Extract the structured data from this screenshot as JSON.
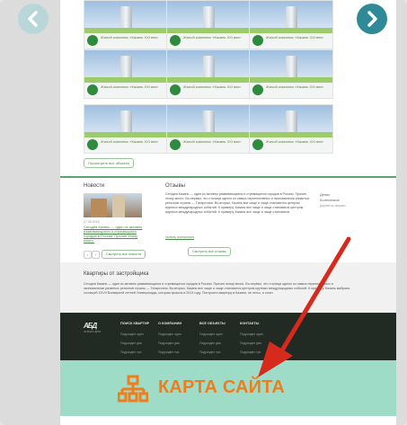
{
  "navigation": {
    "prev_icon": "chevron-left-icon",
    "next_icon": "chevron-right-icon"
  },
  "projects": {
    "tile_caption": "Жилой комплекс «Казань XXI век»",
    "logo_text": "Ак Барс Дом",
    "show_all": "Посмотреть все объекты"
  },
  "news": {
    "title": "Новости",
    "date": "27.08.2015",
    "link": "Сегодня Казань — один из активно развивающихся и стремящихся городов в России. Причин этому много.",
    "pager": [
      "‹",
      "›"
    ],
    "all": "Смотреть все новости"
  },
  "reviews": {
    "title": "Отзывы",
    "text": "Сегодня Казань — один из активно развивающихся и стремящихся городов в России. Причин этому много. Во-первых, это столица одного из самых перспективных и экономически развитых регионов страны — Татарстана. Во-вторых, Казань все чаще и чаще становится центром крупных международных событий. К примеру, Казань все чаще и чаще становится центром крупных международных событий. К примеру, Казань все чаще и чаще становится.",
    "more": "Читать полностью",
    "all": "Смотреть все отзывы",
    "author": "Денис Колесников",
    "role": "Директор фирмы"
  },
  "apartments": {
    "title": "Квартиры от застройщика",
    "text": "Сегодня Казань — один из активно развивающихся и стремящихся городов в России. Причин этому много. Во-первых, это столица одного из самых перспективных и экономически развитых регионов страны — Татарстана. Во-вторых, Казань все чаще и чаще становится центром крупных международных событий. К примеру, Казань выбрана столицей XXVII Всемирной летней Универсиады, которая прошла в 2013 году. Построить квартиру в Казани, не легко, и стоит."
  },
  "footer": {
    "logo": "АБД",
    "logo_sub": "АК БАРС ДОМ",
    "columns": [
      {
        "title": "ПОИСК КВАРТИР",
        "items": [
          "Подраздел один",
          "Подраздел два",
          "Подраздел три"
        ]
      },
      {
        "title": "О КОМПАНИИ",
        "items": [
          "Подраздел один",
          "Подраздел два",
          "Подраздел три"
        ]
      },
      {
        "title": "ВСЕ ОБЪЕКТЫ",
        "items": [
          "Подраздел один",
          "Подраздел два",
          "Подраздел три"
        ]
      },
      {
        "title": "КОНТАКТЫ",
        "items": [
          "Подраздел один",
          "Подраздел два",
          "Подраздел три"
        ]
      }
    ]
  },
  "sitemap": {
    "label": "КАРТА САЙТА",
    "icon": "sitemap-icon"
  },
  "colors": {
    "accent_orange": "#f07d1b",
    "mint": "#9fdcc8",
    "footer_dark": "#222a24",
    "arrow_red": "#d62a1c",
    "teal": "#2f8a98"
  }
}
